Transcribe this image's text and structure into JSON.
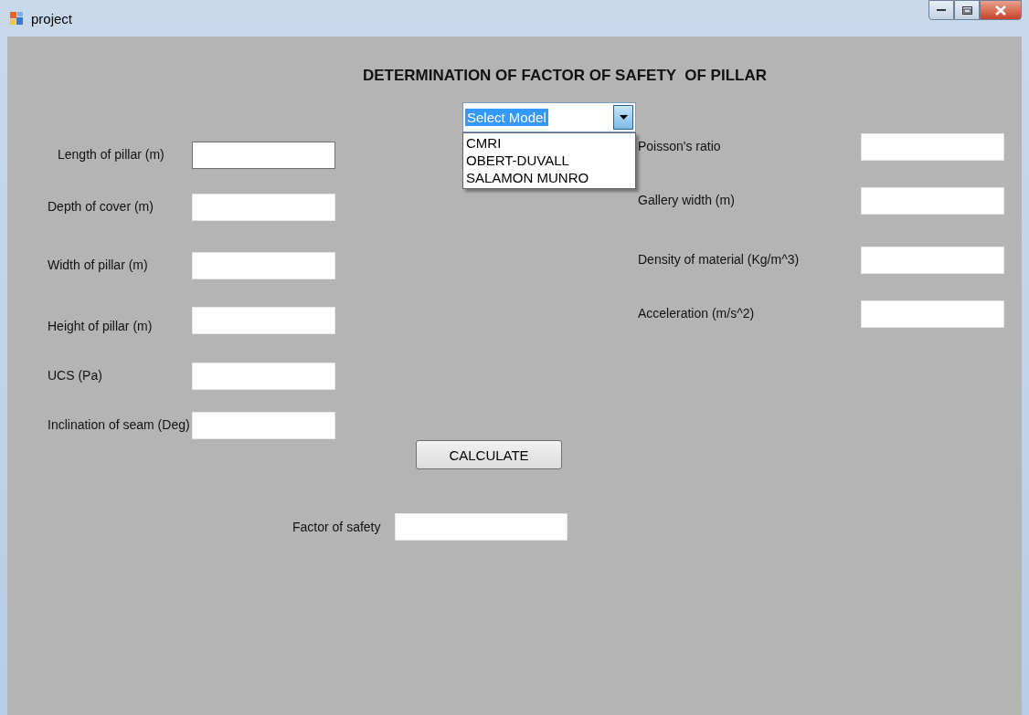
{
  "window": {
    "title": "project"
  },
  "heading": "DETERMINATION OF FACTOR OF SAFETY  OF PILLAR",
  "model_select": {
    "value": "Select Model",
    "highlighted": true,
    "expanded": true,
    "options": [
      "CMRI",
      "OBERT-DUVALL",
      "SALAMON MUNRO"
    ]
  },
  "left_fields": [
    {
      "label": "Length of pillar (m)",
      "focused": true
    },
    {
      "label": "Depth of cover (m)",
      "focused": false
    },
    {
      "label": "Width of pillar (m)",
      "focused": false
    },
    {
      "label": "Height of pillar (m)",
      "focused": false
    },
    {
      "label": "UCS (Pa)",
      "focused": false
    },
    {
      "label": "Inclination of seam (Deg)",
      "focused": false
    }
  ],
  "right_fields": [
    {
      "label": "Poisson's ratio",
      "focused": false
    },
    {
      "label": "Gallery width (m)",
      "focused": false
    },
    {
      "label": "Density of material (Kg/m^3)",
      "focused": false
    },
    {
      "label": "Acceleration (m/s^2)",
      "focused": false
    }
  ],
  "calculate_button": "CALCULATE",
  "result": {
    "label": "Factor of safety"
  }
}
